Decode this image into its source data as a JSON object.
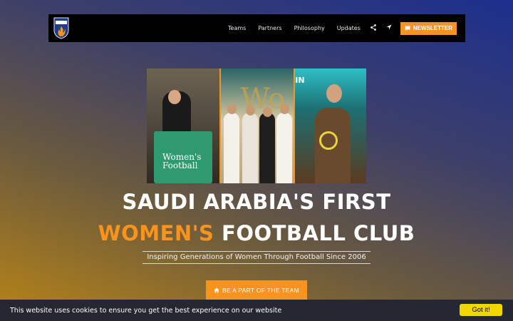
{
  "nav": {
    "logo_icon": "flames-crest-logo",
    "links": [
      "Teams",
      "Partners",
      "Philosophy",
      "Updates"
    ],
    "share_icon": "share-icon",
    "location_icon": "location-arrow-icon",
    "newsletter_icon": "chat-bubble-icon",
    "newsletter_label": "NEWSLETTER"
  },
  "hero": {
    "photo_texts": {
      "panel1_board": "Women's Football",
      "panel2_sign": "Wo",
      "panel3_sign": "IN"
    },
    "title_line1": "SAUDI ARABIA'S FIRST",
    "title_line2_accent": "WOMEN'S",
    "title_line2_rest": " FOOTBALL CLUB",
    "tagline": "Inspiring Generations of Women Through Football Since 2006",
    "cta_icon": "home-icon",
    "cta_label": "BE A PART OF THE TEAM"
  },
  "cookie": {
    "text": "This website uses cookies to ensure you get the best experience on our website",
    "button": "Got it!"
  },
  "colors": {
    "accent": "#f7931e",
    "navbar": "#000000",
    "cookie_bar": "#252733",
    "cookie_button": "#f1d600"
  }
}
